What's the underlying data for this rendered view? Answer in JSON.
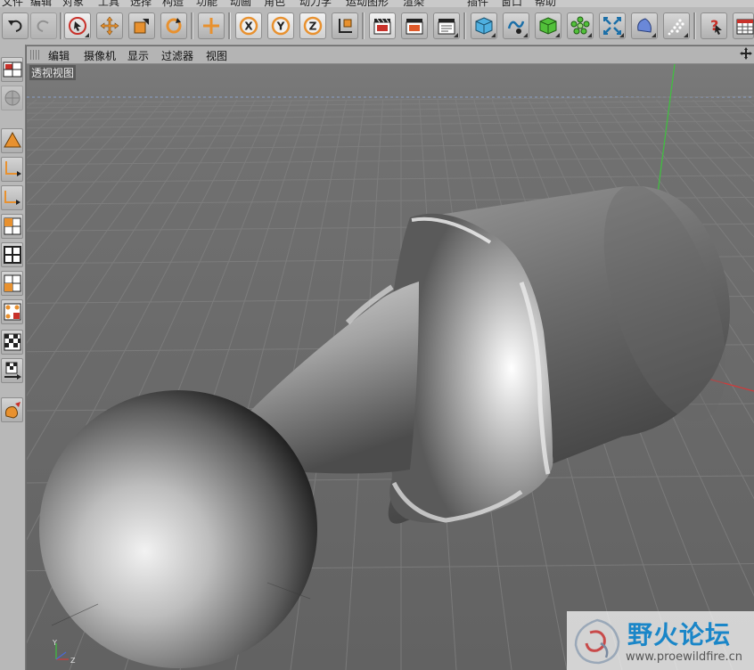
{
  "top_menu": [
    "文件",
    "编辑",
    "对象",
    "工具",
    "选择",
    "构造",
    "功能",
    "动画",
    "角色",
    "动力学",
    "运动图形",
    "渲染",
    "插件",
    "窗口",
    "帮助"
  ],
  "toolbar": {
    "icons": [
      "undo-icon",
      "redo-icon",
      "live-select-icon",
      "move-icon",
      "scale-icon",
      "rotate-icon",
      "world-axis-icon",
      "x-axis-lock-icon",
      "y-axis-lock-icon",
      "z-axis-lock-icon",
      "coordinate-system-icon",
      "render-view-icon",
      "render-picture-viewer-icon",
      "render-settings-icon",
      "cube-primitive-icon",
      "spline-pen-icon",
      "subdivision-nurbs-icon",
      "cloner-array-icon",
      "deformer-icon",
      "scene-environment-icon",
      "light-particles-icon",
      "help-icon",
      "layout-icon"
    ],
    "axis_labels": {
      "x": "X",
      "y": "Y",
      "z": "Z"
    }
  },
  "viewport": {
    "menu": [
      "编辑",
      "摄像机",
      "显示",
      "过滤器",
      "视图"
    ],
    "label": "透视视图"
  },
  "watermark": {
    "title": "野火论坛",
    "url": "www.proewildfire.cn"
  },
  "colors": {
    "accent_orange": "#e8912f",
    "watermark_blue": "#1a86c8",
    "viewport_bg": "#6c6c6c",
    "toolbar_bg": "#b8b8b8"
  }
}
